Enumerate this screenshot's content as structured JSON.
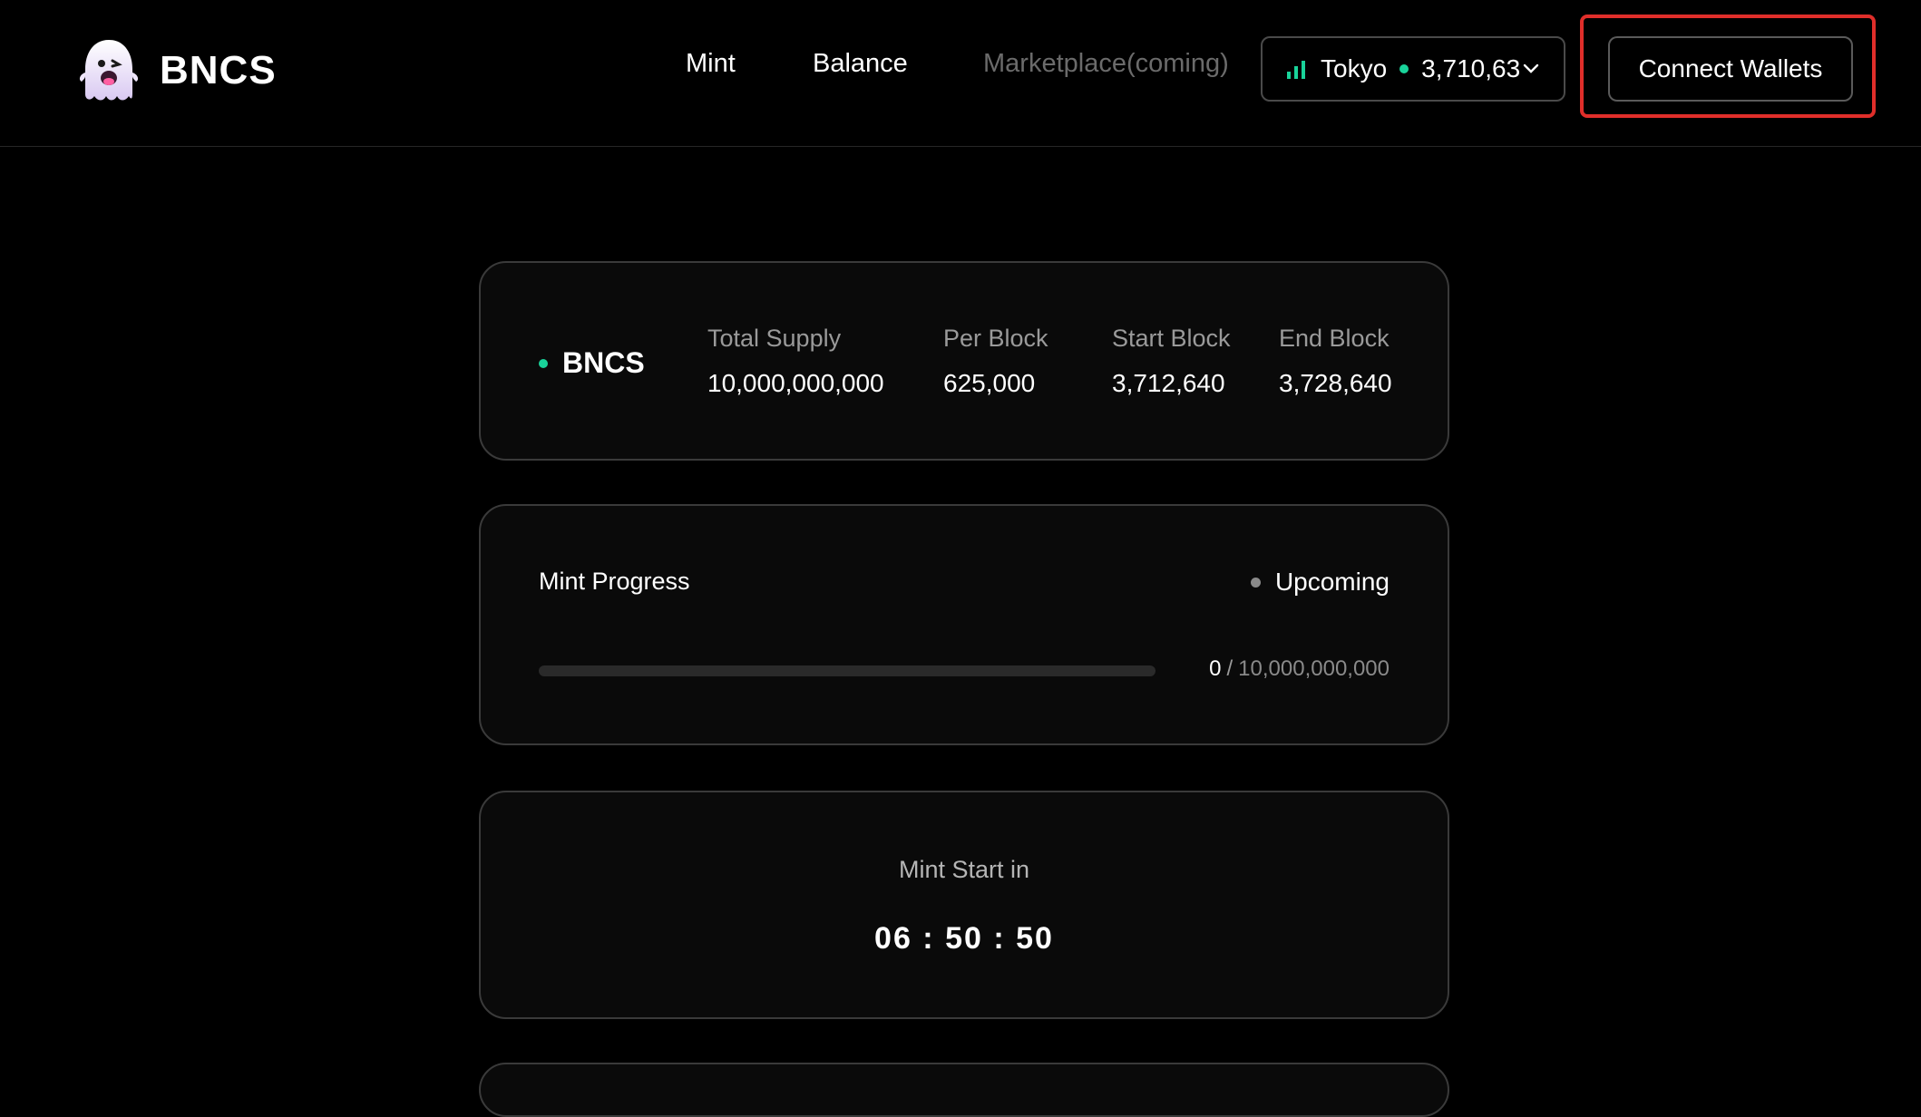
{
  "header": {
    "logo_text": "BNCS",
    "nav": {
      "mint": "Mint",
      "balance": "Balance",
      "marketplace": "Marketplace(coming)"
    },
    "network": {
      "name": "Tokyo",
      "block": "3,710,63",
      "signal_icon": "signal-bars-icon",
      "status_color": "#19d39a"
    },
    "connect_label": "Connect Wallets"
  },
  "token_info": {
    "name": "BNCS",
    "stats": [
      {
        "label": "Total Supply",
        "value": "10,000,000,000"
      },
      {
        "label": "Per Block",
        "value": "625,000"
      },
      {
        "label": "Start Block",
        "value": "3,712,640"
      },
      {
        "label": "End Block",
        "value": "3,728,640"
      }
    ]
  },
  "mint_progress": {
    "title": "Mint Progress",
    "status": "Upcoming",
    "minted": "0",
    "separator": "/",
    "total": "10,000,000,000",
    "progress_percent": 0
  },
  "countdown": {
    "label": "Mint Start in",
    "value": "06 : 50 : 50"
  },
  "colors": {
    "accent": "#19d39a",
    "highlight": "#e02e2a",
    "background": "#000000"
  }
}
